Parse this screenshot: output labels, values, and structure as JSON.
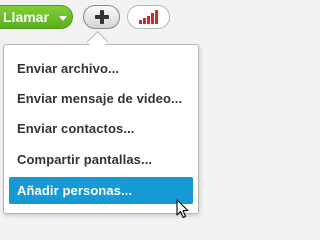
{
  "toolbar": {
    "call_label": "Llamar",
    "call_color": "#6bbf2a",
    "add_icon": "plus-icon",
    "signal_icon": "signal-strength-icon",
    "signal_color": "#d9262c"
  },
  "menu": {
    "items": [
      {
        "label": "Enviar archivo..."
      },
      {
        "label": "Enviar mensaje de video..."
      },
      {
        "label": "Enviar contactos..."
      },
      {
        "label": "Compartir pantallas..."
      },
      {
        "label": "Añadir personas...",
        "highlighted": true
      }
    ],
    "highlight_color": "#1799d6"
  },
  "cursor": {
    "icon": "mouse-pointer-icon"
  }
}
